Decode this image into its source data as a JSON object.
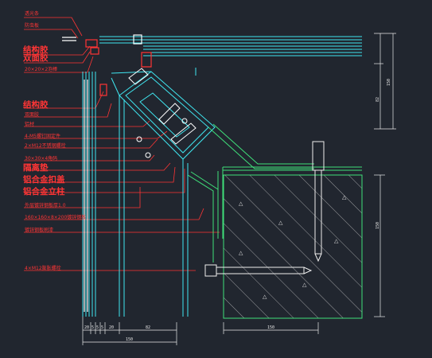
{
  "labels": [
    "透光条",
    "防虫板",
    "结构胶",
    "双面胶",
    "20×20×2泡棒",
    "结构胶",
    "双面胶",
    "铝材",
    "4-M5螺钉固定件",
    "2×M12不锈钢螺栓",
    "30×30×4角码",
    "隔离垫",
    "铝合金扣盖",
    "铝合金立柱",
    "外层镀锌钢板厚1.0",
    "160×160×8×200镀锌钢板",
    "镀锌钢板刷漆",
    "4×M12膨胀螺栓"
  ],
  "dims": {
    "bottom": [
      "20",
      "5",
      "5",
      "5",
      "20",
      "82"
    ],
    "bottom_total": "150",
    "concrete_width": "150",
    "right_outer": "150",
    "right_inner": "82",
    "concrete_height": "150"
  },
  "colors": {
    "background": "#21262f",
    "label_red": "#ff3535",
    "profile_cyan": "#3fe6f0",
    "steel_green": "#3fe07a",
    "concrete_white": "#d9d9d9",
    "bolt_white": "#eeeeee"
  }
}
